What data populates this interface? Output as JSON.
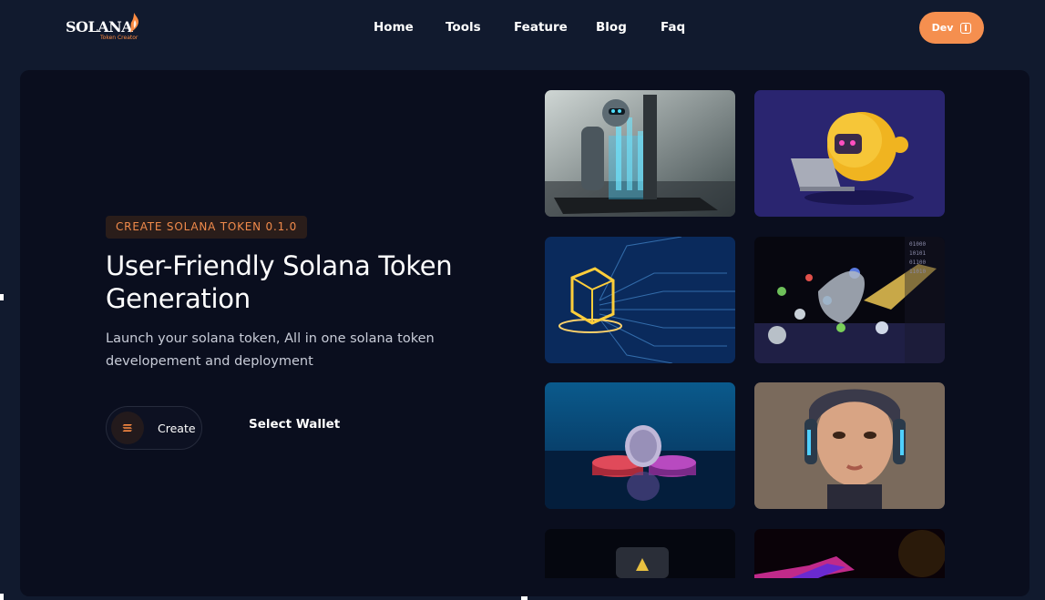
{
  "header": {
    "logo_text": "SOLANA",
    "logo_subtitle": "Token Creator",
    "nav": [
      {
        "label": "Home"
      },
      {
        "label": "Tools"
      },
      {
        "label": "Feature"
      },
      {
        "label": "Blog"
      },
      {
        "label": "Faq"
      }
    ],
    "dev_button": {
      "label": "Dev",
      "icon": "toggle-icon"
    }
  },
  "hero": {
    "badge": "CREATE SOLANA TOKEN 0.1.0",
    "headline": "User-Friendly Solana Token Generation",
    "subtext": "Launch your solana token, All in one solana token developement and deployment",
    "create_button": {
      "label": "Create",
      "icon": "solana-icon"
    },
    "select_wallet_label": "Select Wallet"
  },
  "gallery": {
    "images": [
      {
        "name": "ai-robot-image"
      },
      {
        "name": "yellow-robot-laptop-image"
      },
      {
        "name": "circuit-cube-image"
      },
      {
        "name": "robot-hand-spheres-image"
      },
      {
        "name": "crypto-coins-image"
      },
      {
        "name": "cyborg-woman-image"
      },
      {
        "name": "ethereum-device-image"
      },
      {
        "name": "neon-abstract-image"
      }
    ]
  },
  "colors": {
    "accent": "#f58f4f",
    "background": "#111a2e",
    "card": "#0a0e1e",
    "badge_text": "#f08a4b"
  }
}
